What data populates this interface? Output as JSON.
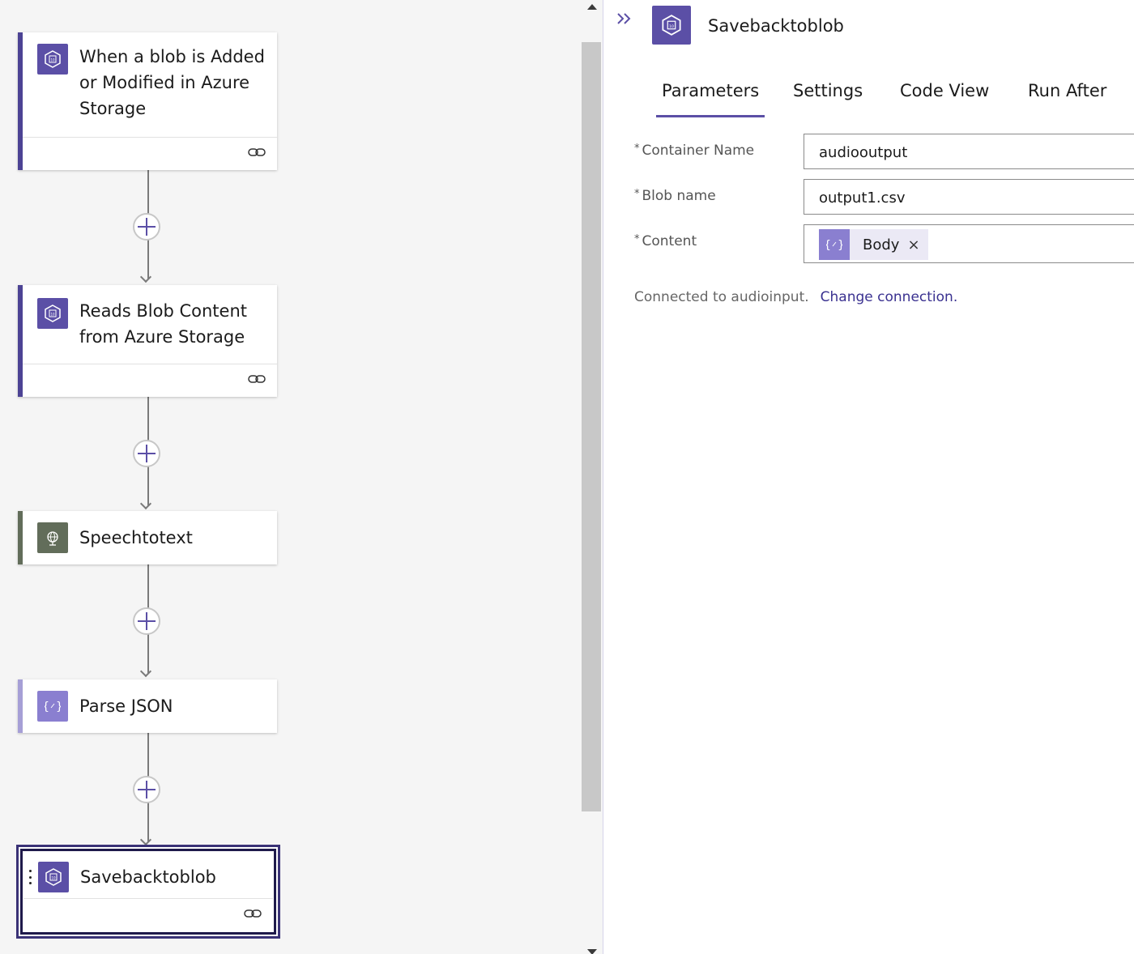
{
  "designer": {
    "steps": [
      {
        "title": "When a blob is Added or Modified in Azure Storage",
        "icon": "azure-blob-icon",
        "accent": "#4c4394"
      },
      {
        "title": "Reads Blob Content from Azure Storage",
        "icon": "azure-blob-icon",
        "accent": "#4c4394"
      },
      {
        "title": "Speechtotext",
        "icon": "globe-icon",
        "accent": "#626d5a"
      },
      {
        "title": "Parse JSON",
        "icon": "braces-icon",
        "accent": "#a69fd6"
      },
      {
        "title": "Savebacktoblob",
        "icon": "azure-blob-icon",
        "accent": "#3a3276",
        "selected": true
      }
    ]
  },
  "panel": {
    "title": "Savebacktoblob",
    "tabs": [
      "Parameters",
      "Settings",
      "Code View",
      "Run After"
    ],
    "active_tab": "Parameters",
    "fields": {
      "container_name": {
        "label": "Container Name",
        "required_mark": "*",
        "value": "audiooutput"
      },
      "blob_name": {
        "label": "Blob name",
        "required_mark": "*",
        "value": "output1.csv"
      },
      "content": {
        "label": "Content",
        "required_mark": "*",
        "token": "Body",
        "token_remove": "×"
      }
    },
    "connection_text": "Connected to audioinput.",
    "change_connection": "Change connection."
  },
  "colors": {
    "brand": "#5b4fa6",
    "canvas_bg": "#f5f5f5",
    "link": "#3a3190"
  }
}
